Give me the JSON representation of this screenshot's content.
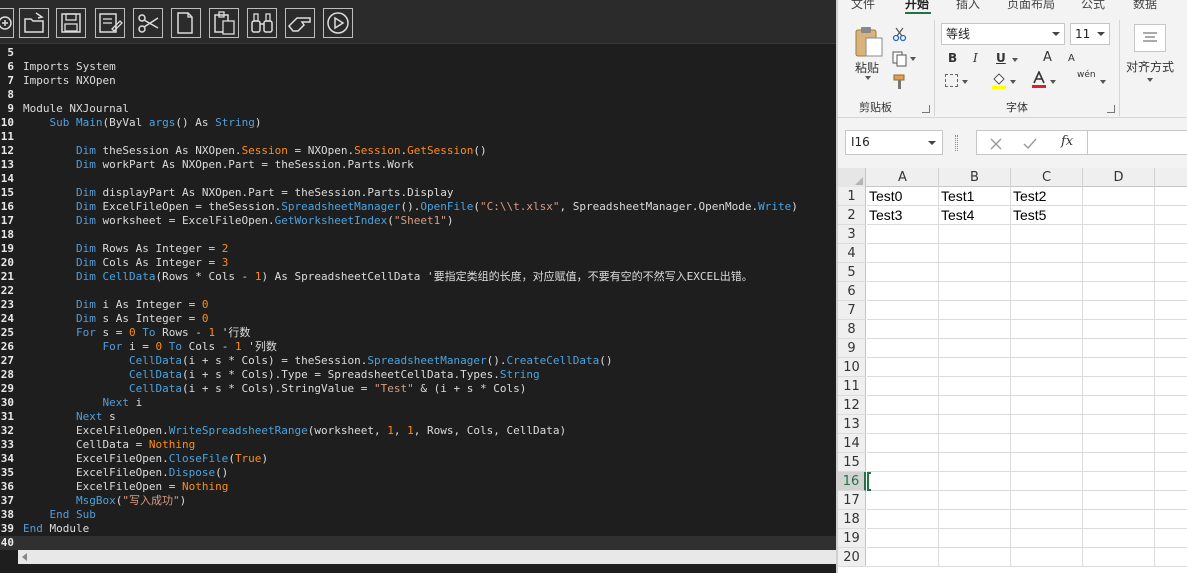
{
  "editor": {
    "toolbar_icons": [
      "new-file-icon",
      "open-file-icon",
      "save-icon",
      "save-as-icon",
      "cut-icon",
      "copy-icon",
      "paste-icon",
      "find-icon",
      "replace-icon",
      "run-icon"
    ],
    "code_lines": [
      {
        "n": "5",
        "t": []
      },
      {
        "n": "6",
        "t": [
          [
            "",
            "Imports System"
          ]
        ]
      },
      {
        "n": "7",
        "t": [
          [
            "",
            "Imports NXOpen"
          ]
        ]
      },
      {
        "n": "8",
        "t": []
      },
      {
        "n": "9",
        "t": [
          [
            "",
            "Module NXJournal"
          ]
        ]
      },
      {
        "n": "10",
        "t": [
          [
            "",
            "    "
          ],
          [
            "k",
            "Sub"
          ],
          [
            "",
            " "
          ],
          [
            "f",
            "Main"
          ],
          [
            "",
            "(ByVal "
          ],
          [
            "f",
            "args"
          ],
          [
            "",
            "() As "
          ],
          [
            "k",
            "String"
          ],
          [
            "",
            ")"
          ]
        ]
      },
      {
        "n": "11",
        "t": []
      },
      {
        "n": "12",
        "t": [
          [
            "",
            "        "
          ],
          [
            "k",
            "Dim"
          ],
          [
            "",
            " theSession As NXOpen."
          ],
          [
            "o",
            "Session"
          ],
          [
            "",
            " = NXOpen."
          ],
          [
            "o",
            "Session"
          ],
          [
            "",
            "."
          ],
          [
            "o",
            "GetSession"
          ],
          [
            "",
            "()"
          ]
        ]
      },
      {
        "n": "13",
        "t": [
          [
            "",
            "        "
          ],
          [
            "k",
            "Dim"
          ],
          [
            "",
            " workPart As NXOpen.Part = theSession.Parts.Work"
          ]
        ]
      },
      {
        "n": "14",
        "t": []
      },
      {
        "n": "15",
        "t": [
          [
            "",
            "        "
          ],
          [
            "k",
            "Dim"
          ],
          [
            "",
            " displayPart As NXOpen.Part = theSession.Parts.Display"
          ]
        ]
      },
      {
        "n": "16",
        "t": [
          [
            "",
            "        "
          ],
          [
            "k",
            "Dim"
          ],
          [
            "",
            " ExcelFileOpen = theSession."
          ],
          [
            "f",
            "SpreadsheetManager"
          ],
          [
            "",
            "()."
          ],
          [
            "f",
            "OpenFile"
          ],
          [
            "",
            "("
          ],
          [
            "s",
            "\"C:\\\\t.xlsx\""
          ],
          [
            "",
            ", SpreadsheetManager.OpenMode."
          ],
          [
            "f",
            "Write"
          ],
          [
            "",
            ")"
          ]
        ]
      },
      {
        "n": "17",
        "t": [
          [
            "",
            "        "
          ],
          [
            "k",
            "Dim"
          ],
          [
            "",
            " worksheet = ExcelFileOpen."
          ],
          [
            "f",
            "GetWorksheetIndex"
          ],
          [
            "",
            "("
          ],
          [
            "s",
            "\"Sheet1\""
          ],
          [
            "",
            ")"
          ]
        ]
      },
      {
        "n": "18",
        "t": []
      },
      {
        "n": "19",
        "t": [
          [
            "",
            "        "
          ],
          [
            "k",
            "Dim"
          ],
          [
            "",
            " Rows As Integer = "
          ],
          [
            "o",
            "2"
          ]
        ]
      },
      {
        "n": "20",
        "t": [
          [
            "",
            "        "
          ],
          [
            "k",
            "Dim"
          ],
          [
            "",
            " Cols As Integer = "
          ],
          [
            "o",
            "3"
          ]
        ]
      },
      {
        "n": "21",
        "t": [
          [
            "",
            "        "
          ],
          [
            "k",
            "Dim"
          ],
          [
            "",
            " "
          ],
          [
            "f",
            "CellData"
          ],
          [
            "",
            "(Rows * Cols - "
          ],
          [
            "o",
            "1"
          ],
          [
            "",
            ") As SpreadsheetCellData '要指定类组的长度，对应赋值，不要有空的不然写入EXCEL出错。"
          ]
        ]
      },
      {
        "n": "22",
        "t": []
      },
      {
        "n": "23",
        "t": [
          [
            "",
            "        "
          ],
          [
            "k",
            "Dim"
          ],
          [
            "",
            " i As Integer = "
          ],
          [
            "o",
            "0"
          ]
        ]
      },
      {
        "n": "24",
        "t": [
          [
            "",
            "        "
          ],
          [
            "k",
            "Dim"
          ],
          [
            "",
            " s As Integer = "
          ],
          [
            "o",
            "0"
          ]
        ]
      },
      {
        "n": "25",
        "t": [
          [
            "",
            "        "
          ],
          [
            "k",
            "For"
          ],
          [
            "",
            " s = "
          ],
          [
            "o",
            "0"
          ],
          [
            "",
            " "
          ],
          [
            "k",
            "To"
          ],
          [
            "",
            " Rows - "
          ],
          [
            "o",
            "1"
          ],
          [
            "",
            " '行数"
          ]
        ]
      },
      {
        "n": "26",
        "t": [
          [
            "",
            "            "
          ],
          [
            "k",
            "For"
          ],
          [
            "",
            " i = "
          ],
          [
            "o",
            "0"
          ],
          [
            "",
            " "
          ],
          [
            "k",
            "To"
          ],
          [
            "",
            " Cols - "
          ],
          [
            "o",
            "1"
          ],
          [
            "",
            " '列数"
          ]
        ]
      },
      {
        "n": "27",
        "t": [
          [
            "",
            "                "
          ],
          [
            "f",
            "CellData"
          ],
          [
            "",
            "(i + s * Cols) = theSession."
          ],
          [
            "f",
            "SpreadsheetManager"
          ],
          [
            "",
            "()."
          ],
          [
            "f",
            "CreateCellData"
          ],
          [
            "",
            "()"
          ]
        ]
      },
      {
        "n": "28",
        "t": [
          [
            "",
            "                "
          ],
          [
            "f",
            "CellData"
          ],
          [
            "",
            "(i + s * Cols).Type = SpreadsheetCellData.Types."
          ],
          [
            "f",
            "String"
          ]
        ]
      },
      {
        "n": "29",
        "t": [
          [
            "",
            "                "
          ],
          [
            "f",
            "CellData"
          ],
          [
            "",
            "(i + s * Cols).StringValue = "
          ],
          [
            "s",
            "\"Test\""
          ],
          [
            "",
            " & (i + s * Cols)"
          ]
        ]
      },
      {
        "n": "30",
        "t": [
          [
            "",
            "            "
          ],
          [
            "k",
            "Next"
          ],
          [
            "",
            " i"
          ]
        ]
      },
      {
        "n": "31",
        "t": [
          [
            "",
            "        "
          ],
          [
            "k",
            "Next"
          ],
          [
            "",
            " s"
          ]
        ]
      },
      {
        "n": "32",
        "t": [
          [
            "",
            "        ExcelFileOpen."
          ],
          [
            "f",
            "WriteSpreadsheetRange"
          ],
          [
            "",
            "(worksheet, "
          ],
          [
            "o",
            "1"
          ],
          [
            "",
            ", "
          ],
          [
            "o",
            "1"
          ],
          [
            "",
            ", Rows, Cols, CellData)"
          ]
        ]
      },
      {
        "n": "33",
        "t": [
          [
            "",
            "        CellData = "
          ],
          [
            "o",
            "Nothing"
          ]
        ]
      },
      {
        "n": "34",
        "t": [
          [
            "",
            "        ExcelFileOpen."
          ],
          [
            "f",
            "CloseFile"
          ],
          [
            "",
            "("
          ],
          [
            "o",
            "True"
          ],
          [
            "",
            ")"
          ]
        ]
      },
      {
        "n": "35",
        "t": [
          [
            "",
            "        ExcelFileOpen."
          ],
          [
            "f",
            "Dispose"
          ],
          [
            "",
            "()"
          ]
        ]
      },
      {
        "n": "36",
        "t": [
          [
            "",
            "        ExcelFileOpen = "
          ],
          [
            "o",
            "Nothing"
          ]
        ]
      },
      {
        "n": "37",
        "t": [
          [
            "",
            "        "
          ],
          [
            "f",
            "MsgBox"
          ],
          [
            "",
            "("
          ],
          [
            "s",
            "\"写入成功\""
          ],
          [
            "",
            ")"
          ]
        ]
      },
      {
        "n": "38",
        "t": [
          [
            "",
            "    "
          ],
          [
            "k",
            "End Sub"
          ]
        ]
      },
      {
        "n": "39",
        "t": [
          [
            "k",
            "End"
          ],
          [
            "",
            " Module"
          ]
        ]
      },
      {
        "n": "40",
        "t": []
      }
    ],
    "current_line": "40"
  },
  "excel": {
    "tabs": [
      "文件",
      "开始",
      "插入",
      "页面布局",
      "公式",
      "数据"
    ],
    "active_tab": "开始",
    "clipboard": {
      "paste_label": "粘贴",
      "group_label": "剪贴板"
    },
    "font": {
      "font_name": "等线",
      "font_size": "11",
      "bold": "B",
      "italic": "I",
      "underline": "U",
      "group_label": "字体",
      "wen_label": "wén",
      "grow": "A",
      "shrink": "A"
    },
    "alignment": {
      "label": "对齐方式"
    },
    "name_box": "I16",
    "fx_label": "fx",
    "columns": [
      "A",
      "B",
      "C",
      "D"
    ],
    "rows": [
      "1",
      "2",
      "3",
      "4",
      "5",
      "6",
      "7",
      "8",
      "9",
      "10",
      "11",
      "12",
      "13",
      "14",
      "15",
      "16",
      "17",
      "18",
      "19",
      "20"
    ],
    "cells": [
      [
        "Test0",
        "Test1",
        "Test2",
        ""
      ],
      [
        "Test3",
        "Test4",
        "Test5",
        ""
      ]
    ],
    "active_row": "16",
    "accent_color": "#217346"
  }
}
